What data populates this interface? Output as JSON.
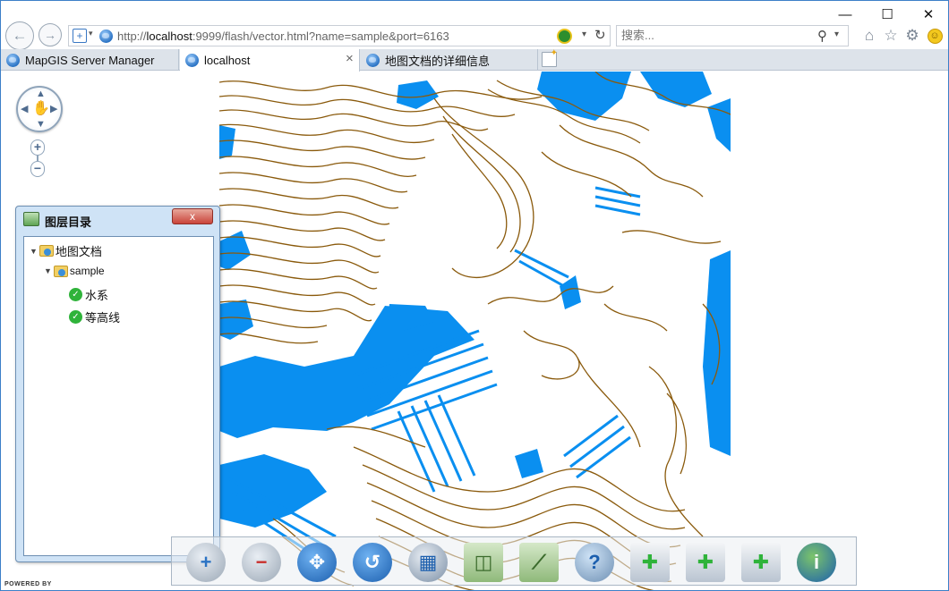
{
  "browser": {
    "window_controls": {
      "minimize": "—",
      "maximize": "☐",
      "close": "✕"
    },
    "address": {
      "url_prefix": "http://",
      "url_host": "localhost",
      "url_rest": ":9999/flash/vector.html?name=sample&port=6163"
    },
    "search": {
      "placeholder": "搜索..."
    },
    "tabs": [
      {
        "label": "MapGIS Server Manager"
      },
      {
        "label": "localhost",
        "close": "×"
      },
      {
        "label": "地图文档的详细信息"
      }
    ]
  },
  "layer_panel": {
    "title": "图层目录",
    "close_label": "x",
    "tree": {
      "root": "地图文档",
      "map": "sample",
      "layers": [
        "水系",
        "等高线"
      ]
    }
  },
  "zoom": {
    "in": "+",
    "out": "−"
  },
  "footer": {
    "powered_by": "POWERED BY"
  },
  "colors": {
    "water": "#0a8ff0",
    "contour": "#8a5a0c",
    "accent": "#3c7fc8"
  },
  "toolbar": {
    "icons": [
      "zoom-in-tool",
      "zoom-out-tool",
      "pan-tool",
      "refresh-tool",
      "layer-tool",
      "map-tool",
      "measure-tool",
      "query-tool",
      "add-point-tool",
      "add-line-tool",
      "add-area-tool",
      "info-tool"
    ]
  }
}
